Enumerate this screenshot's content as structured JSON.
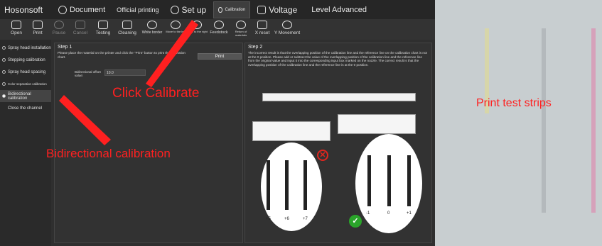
{
  "app": {
    "brand": "Hosonsoft"
  },
  "menu": [
    {
      "label": "Document",
      "icon": "document-icon"
    },
    {
      "label": "Official printing",
      "icon": ""
    },
    {
      "label": "Set up",
      "icon": "gear-icon"
    },
    {
      "label": "Calibration",
      "icon": "calibration-icon"
    },
    {
      "label": "Voltage",
      "icon": "voltage-icon"
    },
    {
      "label": "Level Advanced",
      "icon": ""
    }
  ],
  "toolbar": [
    {
      "label": "Open",
      "icon": "open-icon"
    },
    {
      "label": "Print",
      "icon": "print-icon"
    },
    {
      "label": "Pause",
      "icon": "pause-icon"
    },
    {
      "label": "Cancel",
      "icon": "cancel-icon"
    },
    {
      "label": "Testing",
      "icon": "testing-icon"
    },
    {
      "label": "Cleaning",
      "icon": "cleaning-icon"
    },
    {
      "label": "White border",
      "icon": "white-border-icon"
    },
    {
      "label": "Move to the left",
      "icon": "move-left-icon"
    },
    {
      "label": "Move to the right",
      "icon": "move-right-icon"
    },
    {
      "label": "Feedstock",
      "icon": "feedstock-icon"
    },
    {
      "label": "Return of materials",
      "icon": "return-icon"
    },
    {
      "label": "X reset",
      "icon": "x-reset-icon"
    },
    {
      "label": "Y Movement",
      "icon": "y-movement-icon"
    }
  ],
  "sidebar": [
    {
      "label": "Spray head installation"
    },
    {
      "label": "Stepping calibration"
    },
    {
      "label": "Spray head spacing"
    },
    {
      "label": "Color separation calibration"
    },
    {
      "label": "Bidirectional calibration"
    },
    {
      "label": "Close the channel"
    }
  ],
  "step1": {
    "title": "Step 1",
    "instruction": "Please place the material on the printer and click the \"Print\" button to print the calibration chart.",
    "print_button": "Print",
    "offset_label": "Bidirectional offset value:",
    "offset_value": "10.0"
  },
  "step2": {
    "title": "Step 2",
    "text": "The incorrect result is that the overlapping position of the calibration line and the reference line on the calibration chart is not at the 0 position. Please add or subtract the value of the overlapping position of the calibration line and the reference line from the original value and input it into the corresponding input box marked on the nozzle. The correct result is that the overlapping position of the calibration line and the reference line is at the 0 position.",
    "wrong_labels": [
      "+5",
      "+6",
      "+7"
    ],
    "right_labels": [
      "-1",
      "0",
      "+1"
    ]
  },
  "annotations": {
    "click_calibrate": "Click Calibrate",
    "bidirectional": "Bidirectional calibration",
    "print_strips": "Print test strips"
  },
  "colors": {
    "annotation": "#ff2020",
    "wrong": "#e0261f",
    "right": "#2aa52a"
  }
}
